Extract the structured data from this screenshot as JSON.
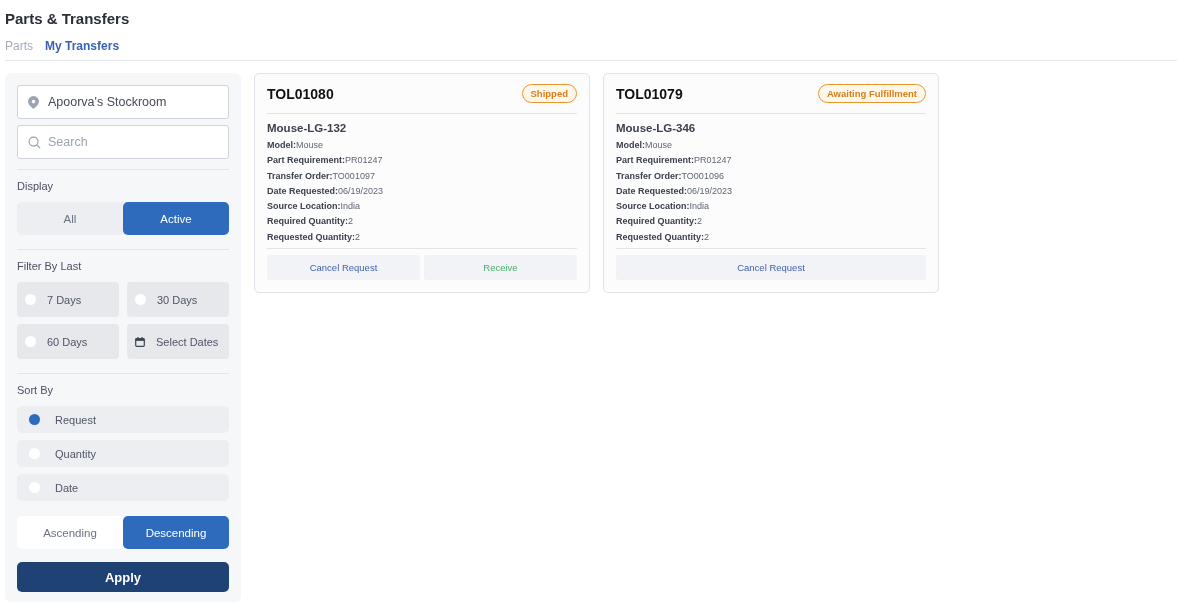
{
  "page_title": "Parts & Transfers",
  "tabs": [
    {
      "label": "Parts",
      "selected": false
    },
    {
      "label": "My Transfers",
      "selected": true
    }
  ],
  "sidebar": {
    "location": {
      "value": "Apoorva's Stockroom"
    },
    "search": {
      "placeholder": "Search"
    },
    "display": {
      "title": "Display",
      "options": [
        {
          "label": "All",
          "selected": false
        },
        {
          "label": "Active",
          "selected": true
        }
      ]
    },
    "filter": {
      "title": "Filter By Last",
      "options": [
        {
          "kind": "radio",
          "label": "7 Days",
          "selected": false
        },
        {
          "kind": "radio",
          "label": "30 Days",
          "selected": false
        },
        {
          "kind": "radio",
          "label": "60 Days",
          "selected": false
        },
        {
          "kind": "dates",
          "label": "Select Dates",
          "selected": false
        }
      ]
    },
    "sort": {
      "title": "Sort By",
      "options": [
        {
          "label": "Request",
          "selected": true
        },
        {
          "label": "Quantity",
          "selected": false
        },
        {
          "label": "Date",
          "selected": false
        }
      ]
    },
    "order": [
      {
        "label": "Ascending",
        "selected": false
      },
      {
        "label": "Descending",
        "selected": true
      }
    ],
    "apply": "Apply"
  },
  "cards": [
    {
      "id": "TOL01080",
      "status": "Shipped",
      "part": "Mouse-LG-132",
      "fields": [
        {
          "label": "Model:",
          "value": "Mouse"
        },
        {
          "label": "Part Requirement:",
          "value": "PR01247"
        },
        {
          "label": "Transfer Order:",
          "value": "TO001097"
        },
        {
          "label": "Date Requested:",
          "value": "06/19/2023"
        },
        {
          "label": "Source Location:",
          "value": "India"
        },
        {
          "label": "Required Quantity:",
          "value": "2"
        },
        {
          "label": "Requested Quantity:",
          "value": "2"
        }
      ],
      "actions": [
        {
          "kind": "cancel",
          "label": "Cancel Request"
        },
        {
          "kind": "receive",
          "label": "Receive"
        }
      ]
    },
    {
      "id": "TOL01079",
      "status": "Awaiting Fulfillment",
      "part": "Mouse-LG-346",
      "fields": [
        {
          "label": "Model:",
          "value": "Mouse"
        },
        {
          "label": "Part Requirement:",
          "value": "PR01247"
        },
        {
          "label": "Transfer Order:",
          "value": "TO001096"
        },
        {
          "label": "Date Requested:",
          "value": "06/19/2023"
        },
        {
          "label": "Source Location:",
          "value": "India"
        },
        {
          "label": "Required Quantity:",
          "value": "2"
        },
        {
          "label": "Requested Quantity:",
          "value": "2"
        }
      ],
      "actions": [
        {
          "kind": "cancel",
          "label": "Cancel Request"
        }
      ]
    }
  ]
}
